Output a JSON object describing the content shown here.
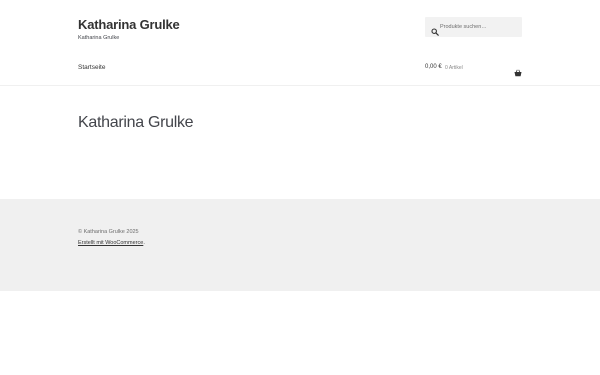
{
  "header": {
    "site_title": "Katharina Grulke",
    "site_description": "Katharina Grulke",
    "search": {
      "placeholder": "Produkte suchen…",
      "value": "",
      "icon": "search-icon"
    },
    "nav": {
      "items": [
        {
          "label": "Startseite"
        }
      ]
    },
    "cart": {
      "amount": "0,00 €",
      "count_label": "0 Artikel",
      "icon": "basket-icon"
    }
  },
  "main": {
    "page_title": "Katharina Grulke"
  },
  "footer": {
    "copyright": "© Katharina Grulke 2025",
    "credit_link": "Erstellt mit WooCommerce",
    "credit_suffix": "."
  },
  "colors": {
    "footer_bg": "#f0f0f0",
    "search_bg": "#f2f2f2",
    "text": "#43454b",
    "heading": "#333333"
  }
}
